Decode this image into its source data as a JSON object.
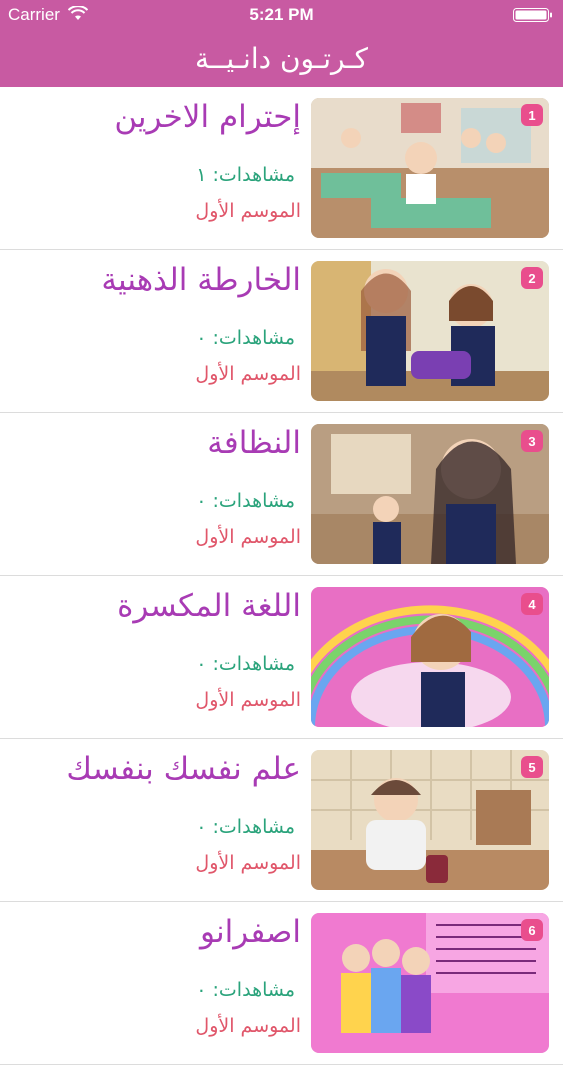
{
  "status_bar": {
    "carrier": "Carrier",
    "time": "5:21 PM"
  },
  "nav": {
    "title": "كـرتـون دانـيــة"
  },
  "colors": {
    "header": "#c85aa2",
    "title": "#a83bb4",
    "views": "#2aa37b",
    "season": "#e0566a",
    "badge": "#e94e8d"
  },
  "episodes": [
    {
      "number": "1",
      "title": "إحترام الاخرين",
      "views": "مشاهدات: ١",
      "season": "الموسم الأول"
    },
    {
      "number": "2",
      "title": "الخارطة الذهنية",
      "views": "مشاهدات: ٠",
      "season": "الموسم الأول"
    },
    {
      "number": "3",
      "title": "النظافة",
      "views": "مشاهدات: ٠",
      "season": "الموسم الأول"
    },
    {
      "number": "4",
      "title": "اللغة المكسرة",
      "views": "مشاهدات: ٠",
      "season": "الموسم الأول"
    },
    {
      "number": "5",
      "title": "علم نفسك بنفسك",
      "views": "مشاهدات: ٠",
      "season": "الموسم الأول"
    },
    {
      "number": "6",
      "title": "اصفرانو",
      "views": "مشاهدات: ٠",
      "season": "الموسم الأول"
    }
  ]
}
